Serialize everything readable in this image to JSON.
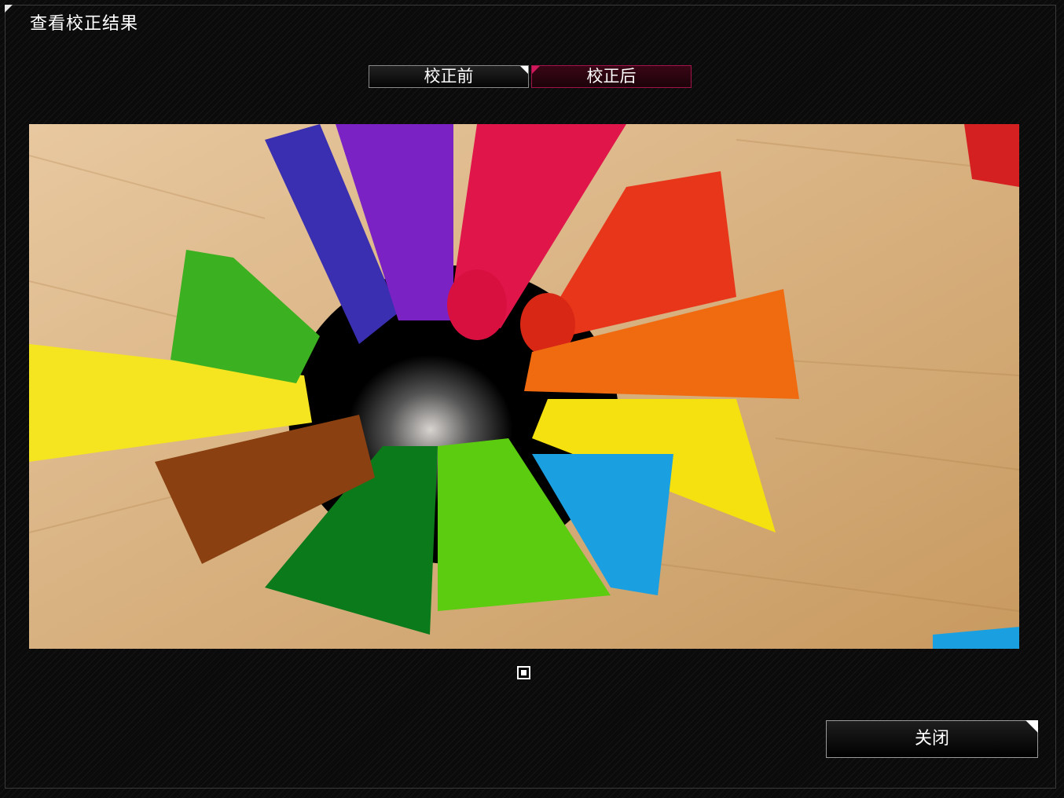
{
  "window": {
    "title": "查看校正结果"
  },
  "tabs": [
    {
      "label": "校正前",
      "active": false
    },
    {
      "label": "校正后",
      "active": true
    }
  ],
  "preview": {
    "icon": "colored-pencils-photo",
    "pencil_colors": [
      "#3a2fb0",
      "#7a22c4",
      "#e0154a",
      "#e8361a",
      "#d42020",
      "#f06a10",
      "#f5e010",
      "#1aa0e0",
      "#5ccc10",
      "#0a7a1a",
      "#8a4010",
      "#f5e420",
      "#3bb020"
    ]
  },
  "footer": {
    "close_label": "关闭"
  },
  "colors": {
    "accent": "#a0144a",
    "background": "#0b0b0b"
  }
}
